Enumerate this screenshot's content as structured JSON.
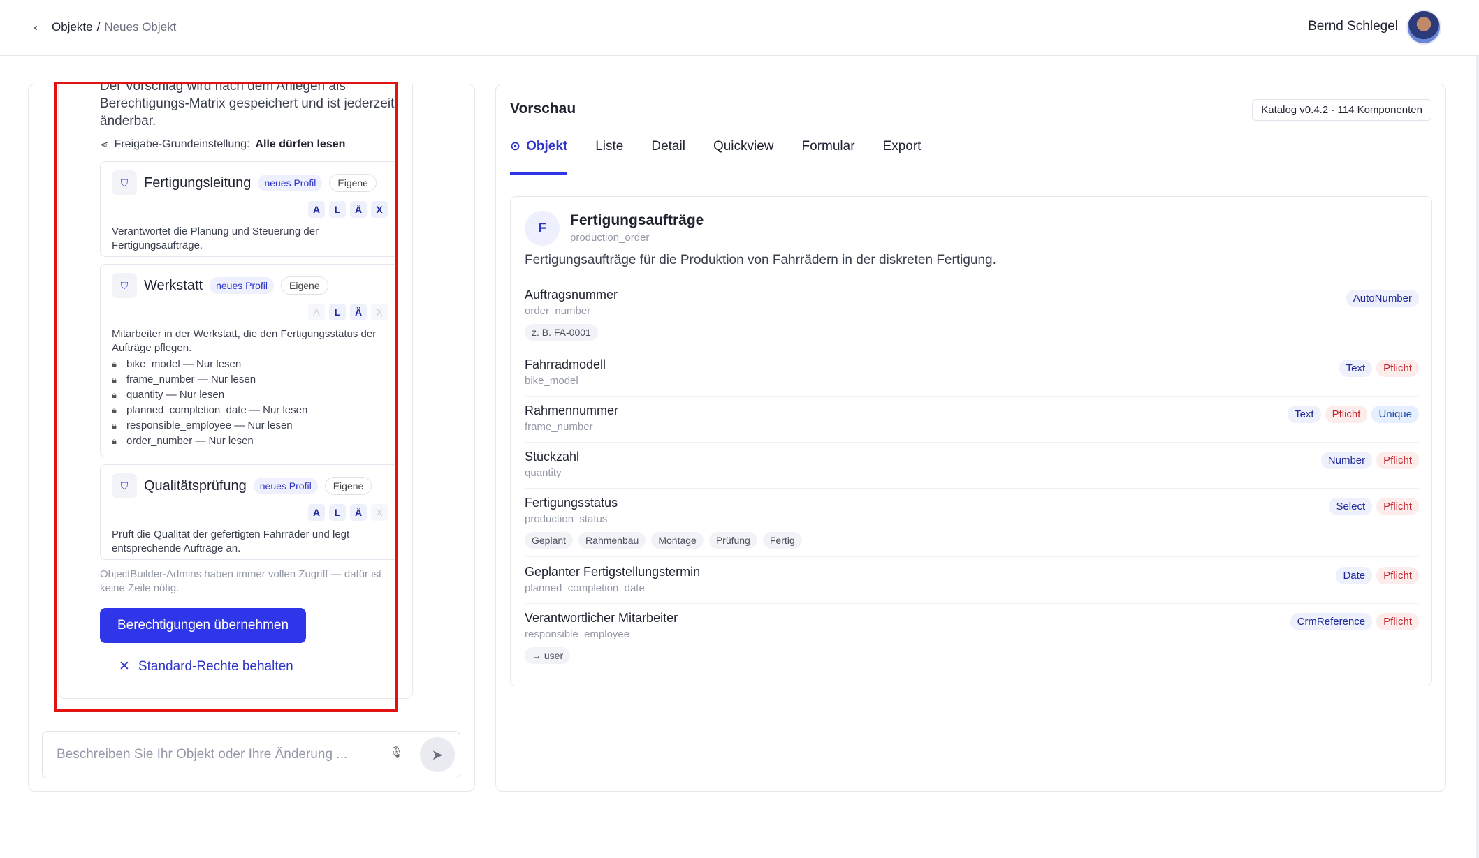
{
  "breadcrumb": {
    "parent": "Objekte",
    "separator": "/",
    "current": "Neues Objekt"
  },
  "user": {
    "name": "Bernd Schlegel"
  },
  "left": {
    "intro": "Der Vorschlag wird nach dem Anlegen als Berechtigungs-Matrix gespeichert und ist jederzeit änderbar.",
    "share_label": "Freigabe-Grundeinstellung:",
    "share_value": "Alle dürfen lesen",
    "profiles": [
      {
        "title": "Fertigungsleitung",
        "badge_new": "neues Profil",
        "badge_own": "Eigene",
        "perms": [
          {
            "k": "A",
            "on": true
          },
          {
            "k": "L",
            "on": true
          },
          {
            "k": "Ä",
            "on": true
          },
          {
            "k": "X",
            "on": true
          }
        ],
        "desc": "Verantwortet die Planung und Steuerung der Fertigungsaufträge.",
        "locks": []
      },
      {
        "title": "Werkstatt",
        "badge_new": "neues Profil",
        "badge_own": "Eigene",
        "perms": [
          {
            "k": "A",
            "on": false
          },
          {
            "k": "L",
            "on": true
          },
          {
            "k": "Ä",
            "on": true
          },
          {
            "k": "X",
            "on": false
          }
        ],
        "desc": "Mitarbeiter in der Werkstatt, die den Fertigungsstatus der Aufträge pflegen.",
        "locks": [
          "bike_model — Nur lesen",
          "frame_number — Nur lesen",
          "quantity — Nur lesen",
          "planned_completion_date — Nur lesen",
          "responsible_employee — Nur lesen",
          "order_number — Nur lesen"
        ]
      },
      {
        "title": "Qualitätsprüfung",
        "badge_new": "neues Profil",
        "badge_own": "Eigene",
        "perms": [
          {
            "k": "A",
            "on": true
          },
          {
            "k": "L",
            "on": true
          },
          {
            "k": "Ä",
            "on": true
          },
          {
            "k": "X",
            "on": false
          }
        ],
        "desc": "Prüft die Qualität der gefertigten Fahrräder und legt entsprechende Aufträge an.",
        "locks": []
      }
    ],
    "admin_note": "ObjectBuilder-Admins haben immer vollen Zugriff — dafür ist keine Zeile nötig.",
    "apply_label": "Berechtigungen übernehmen",
    "keep_label": "Standard-Rechte behalten",
    "input_placeholder": "Beschreiben Sie Ihr Objekt oder Ihre Änderung ..."
  },
  "preview": {
    "title": "Vorschau",
    "catalog": "Katalog v0.4.2 · 114 Komponenten",
    "tabs": [
      "Objekt",
      "Liste",
      "Detail",
      "Quickview",
      "Formular",
      "Export"
    ],
    "object": {
      "initial": "F",
      "name": "Fertigungsaufträge",
      "key": "production_order",
      "desc": "Fertigungsaufträge für die Produktion von Fahrrädern in der diskreten Fertigung."
    },
    "fields": [
      {
        "name": "Auftragsnummer",
        "key": "order_number",
        "chips": [
          "z. B. FA-0001"
        ],
        "tags": [
          {
            "t": "AutoNumber",
            "k": "type"
          }
        ]
      },
      {
        "name": "Fahrradmodell",
        "key": "bike_model",
        "chips": [],
        "tags": [
          {
            "t": "Text",
            "k": "type"
          },
          {
            "t": "Pflicht",
            "k": "req"
          }
        ]
      },
      {
        "name": "Rahmennummer",
        "key": "frame_number",
        "chips": [],
        "tags": [
          {
            "t": "Text",
            "k": "type"
          },
          {
            "t": "Pflicht",
            "k": "req"
          },
          {
            "t": "Unique",
            "k": "uniq"
          }
        ]
      },
      {
        "name": "Stückzahl",
        "key": "quantity",
        "chips": [],
        "tags": [
          {
            "t": "Number",
            "k": "type"
          },
          {
            "t": "Pflicht",
            "k": "req"
          }
        ]
      },
      {
        "name": "Fertigungsstatus",
        "key": "production_status",
        "chips": [
          "Geplant",
          "Rahmenbau",
          "Montage",
          "Prüfung",
          "Fertig"
        ],
        "tags": [
          {
            "t": "Select",
            "k": "type"
          },
          {
            "t": "Pflicht",
            "k": "req"
          }
        ]
      },
      {
        "name": "Geplanter Fertigstellungstermin",
        "key": "planned_completion_date",
        "chips": [],
        "tags": [
          {
            "t": "Date",
            "k": "type"
          },
          {
            "t": "Pflicht",
            "k": "req"
          }
        ]
      },
      {
        "name": "Verantwortlicher Mitarbeiter",
        "key": "responsible_employee",
        "chips": [
          "→ user"
        ],
        "tags": [
          {
            "t": "CrmReference",
            "k": "type"
          },
          {
            "t": "Pflicht",
            "k": "req"
          }
        ]
      }
    ]
  }
}
